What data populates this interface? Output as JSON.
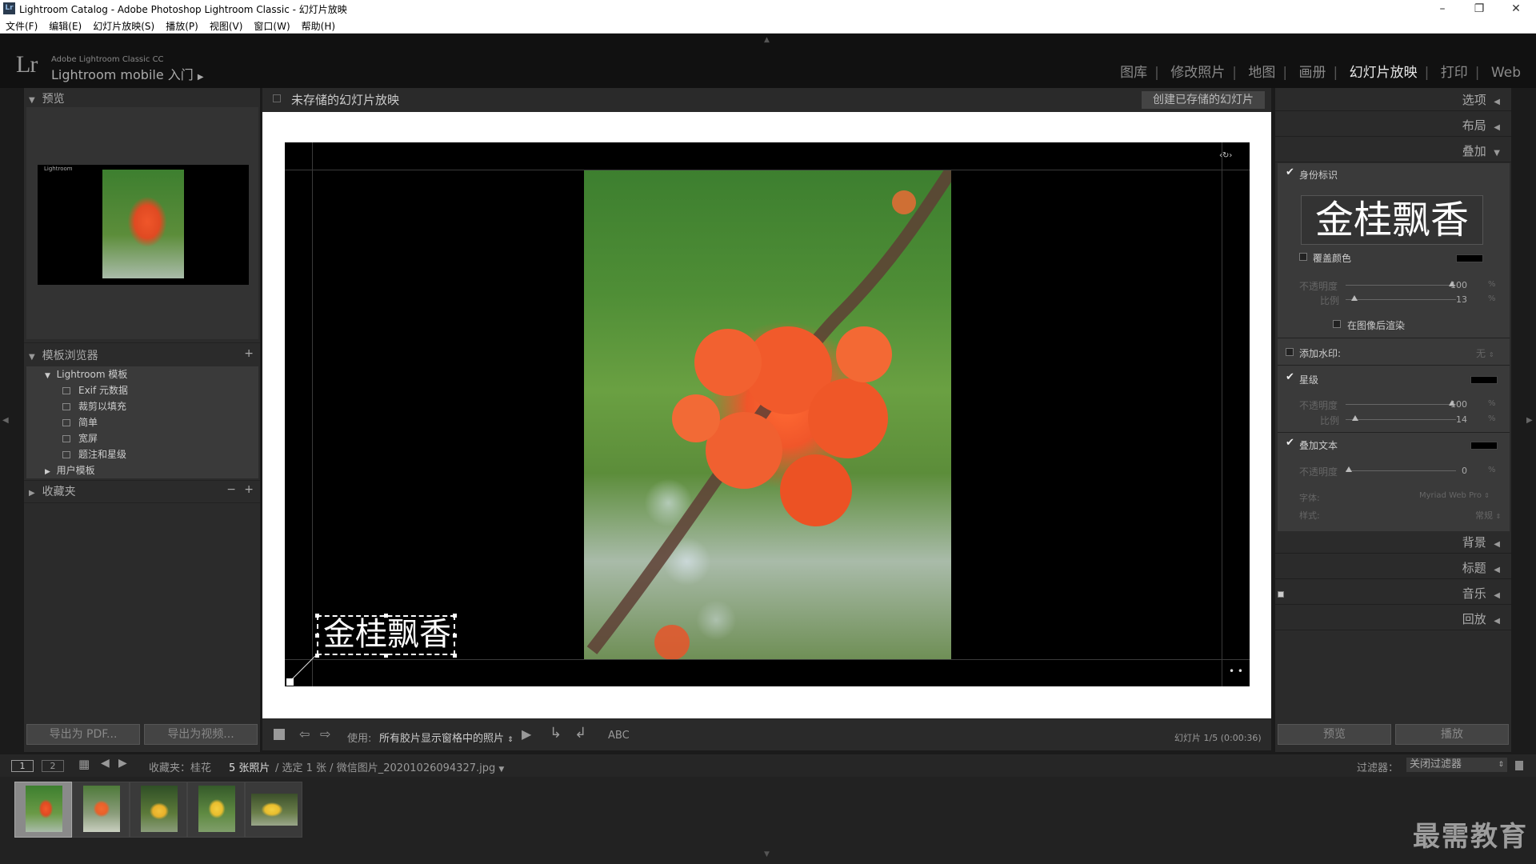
{
  "window": {
    "title": "Lightroom Catalog - Adobe Photoshop Lightroom Classic - 幻灯片放映",
    "app_icon": "Lr"
  },
  "menu": [
    "文件(F)",
    "编辑(E)",
    "幻灯片放映(S)",
    "播放(P)",
    "视图(V)",
    "窗口(W)",
    "帮助(H)"
  ],
  "identity": {
    "logo": "Lr",
    "small": "Adobe Lightroom Classic CC",
    "big": "Lightroom mobile 入门"
  },
  "modules": [
    "图库",
    "修改照片",
    "地图",
    "画册",
    "幻灯片放映",
    "打印",
    "Web"
  ],
  "left": {
    "preview_title": "预览",
    "preview_label": "Lightroom",
    "template_title": "模板浏览器",
    "lr_templates": "Lightroom 模板",
    "templates": [
      "Exif 元数据",
      "裁剪以填充",
      "简单",
      "宽屏",
      "题注和星级"
    ],
    "user_templates": "用户模板",
    "collections_title": "收藏夹",
    "export_pdf": "导出为 PDF...",
    "export_video": "导出为视频..."
  },
  "center": {
    "title": "未存储的幻灯片放映",
    "save_btn": "创建已存储的幻灯片",
    "overlay_text": "金桂飘香",
    "use_label": "使用:",
    "use_value": "所有胶片显示窗格中的照片",
    "abc": "ABC",
    "slide_info": "幻灯片 1/5 (0:00:36)"
  },
  "right": {
    "options": "选项",
    "layout": "布局",
    "overlays": "叠加",
    "identity_plate": "身份标识",
    "plate_text": "金桂飘香",
    "override_color": "覆盖颜色",
    "opacity": "不透明度",
    "scale": "比例",
    "plate_opacity": "100",
    "plate_scale": "13",
    "pct": "%",
    "render_behind": "在图像后渲染",
    "watermark": "添加水印:",
    "watermark_val": "无",
    "rating": "星级",
    "rating_opacity": "100",
    "rating_scale": "14",
    "text_overlay": "叠加文本",
    "text_opacity": "0",
    "font_label": "字体:",
    "font_val": "Myriad Web Pro",
    "style_label": "样式:",
    "style_val": "常规",
    "backdrop": "背景",
    "titles": "标题",
    "music": "音乐",
    "playback": "回放",
    "preview_btn": "预览",
    "play_btn": "播放"
  },
  "filmstrip": {
    "page1": "1",
    "page2": "2",
    "source": "收藏夹：桂花",
    "count": "5 张照片",
    "selection": "/ 选定 1 张 / 微信图片_20201026094327.jpg",
    "filter_label": "过滤器：",
    "filter_value": "关闭过滤器"
  },
  "watermark_text": "最需教育"
}
